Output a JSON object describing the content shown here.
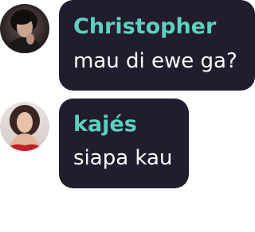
{
  "messages": [
    {
      "sender": "Christopher",
      "text": "mau di ewe ga?",
      "avatar": "profile-photo-dark"
    },
    {
      "sender": "kajés",
      "text": "siapa kau",
      "avatar": "profile-photo-woman"
    }
  ],
  "colors": {
    "bubble": "#211c2e",
    "sender_name": "#5ed1bd",
    "message_text": "#ffffff",
    "background": "#ffffff"
  }
}
